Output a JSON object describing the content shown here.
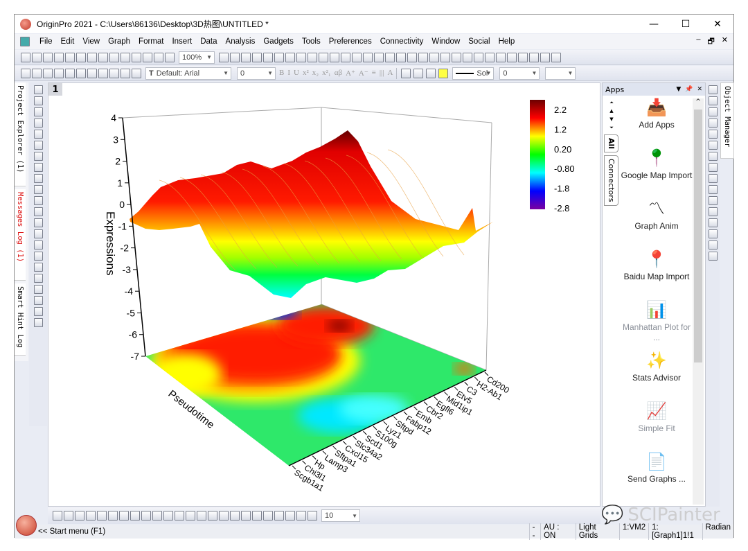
{
  "window": {
    "title": "OriginPro 2021 - C:\\Users\\86136\\Desktop\\3D热图\\UNTITLED *",
    "minimize": "—",
    "maximize": "☐",
    "close": "✕"
  },
  "menu": {
    "items": [
      "File",
      "Edit",
      "View",
      "Graph",
      "Format",
      "Insert",
      "Data",
      "Analysis",
      "Gadgets",
      "Tools",
      "Preferences",
      "Connectivity",
      "Window",
      "Social",
      "Help"
    ],
    "mdi": [
      "–",
      "🗗",
      "✕"
    ]
  },
  "toolbar1": {
    "zoom": "100%",
    "icons": [
      "new-project-icon",
      "new-folder-icon",
      "new-workbook-icon",
      "new-graph-icon",
      "new-matrix-icon",
      "new-function-icon",
      "new-layout-icon",
      "new-notes-icon",
      "new-excel-icon",
      "open-icon",
      "open-template-icon",
      "save-icon",
      "save-template-icon",
      "script-icon"
    ],
    "icons2": [
      "print-icon",
      "duplicate-icon",
      "refresh-icon",
      "film-icon",
      "code-builder-icon",
      "results-log-icon",
      "command-window-icon",
      "project-tree-icon",
      "find-icon",
      "worksheet-icon",
      "notes-icon",
      "settings-gear-icon",
      "add-column-icon",
      "sum-icon",
      "stats-icon",
      "sort-icon",
      "frequency-icon",
      "bar-chart-icon",
      "column-chart-icon",
      "box-chart-icon",
      "filter-icon",
      "clear-filter-icon",
      "reapply-filter-icon",
      "peak-icon",
      "x-icon",
      "y-icon",
      "z-icon",
      "error-icon",
      "none-icon",
      "first-icon",
      "prev-icon"
    ]
  },
  "toolbar2": {
    "font": "Default: Arial",
    "font_size": "0",
    "line_style": "Sol",
    "line_width": "0",
    "icons": [
      "import-ascii-icon",
      "import-multi-icon",
      "import-excel-icon",
      "import-wizard-icon",
      "copy-page-icon",
      "add-layer-icon",
      "merge-icon",
      "extract-icon",
      "cut-icon",
      "copy-icon",
      "paste-icon"
    ],
    "fmt": [
      "B",
      "I",
      "U",
      "x²",
      "x₂",
      "x²₁",
      "αβ",
      "A⁺",
      "A⁻",
      "≡",
      "|||",
      "A"
    ]
  },
  "left_tabs": [
    {
      "label": "Project Explorer (1)"
    },
    {
      "label": "Messages Log (1)"
    },
    {
      "label": "Smart Hint Log"
    }
  ],
  "left_tools": [
    "pointer-icon",
    "zoom-in-icon",
    "zoom-out-icon",
    "scale-icon",
    "data-reader-icon",
    "screen-reader-icon",
    "draw-data-icon",
    "region-icon",
    "text-tool-icon",
    "add-graph-icon",
    "arrow-tool-icon",
    "line-tool-icon",
    "rectangle-tool-icon",
    "hand-icon",
    "scale-in-icon",
    "rescale-icon",
    "mask-icon",
    "color-scale-icon",
    "layer-icon",
    "lock-icon",
    "new-layout-icon",
    "table-icon"
  ],
  "graph": {
    "layer": "1"
  },
  "chart_data": {
    "type": "3d-surface-with-projected-contour",
    "zlabel": "Expressions",
    "xlabel": "Pseudotime",
    "z_ticks": [
      4,
      3,
      2,
      1,
      0,
      -1,
      -2,
      -3,
      -4,
      -5,
      -6,
      -7
    ],
    "zlim": [
      -7,
      4
    ],
    "y_categories": [
      "Scgb1a1",
      "Chi3l1",
      "Hp",
      "Lamp3",
      "Sftpa1",
      "Cxcl15",
      "Slc34a2",
      "Scd1",
      "S100g",
      "Lyz1",
      "Sftpd",
      "Fabp12",
      "Emb",
      "Cbr2",
      "Egfl6",
      "Mid1ip1",
      "Etv5",
      "C3",
      "H2-Ab1",
      "Cd200"
    ],
    "colorbar": {
      "ticks": [
        "2.2",
        "1.2",
        "0.20",
        "-0.80",
        "-1.8",
        "-2.8"
      ],
      "colors": [
        "#6b0000",
        "#ff0000",
        "#ffff00",
        "#00ff00",
        "#00ffff",
        "#0000ff",
        "#7a00a0"
      ]
    },
    "surface_max": 3.2,
    "surface_min": -4.4
  },
  "apps": {
    "title": "Apps",
    "tabs": [
      "All",
      "Connectors"
    ],
    "items": [
      {
        "label": "Add Apps",
        "icon": "add-apps-icon",
        "dim": false
      },
      {
        "label": "Google Map Import",
        "icon": "google-map-pin-icon",
        "dim": false
      },
      {
        "label": "Graph Anim",
        "icon": "graph-anim-icon",
        "dim": false
      },
      {
        "label": "Baidu Map Import",
        "icon": "baidu-map-pin-icon",
        "dim": false
      },
      {
        "label": "Manhattan Plot for ...",
        "icon": "manhattan-plot-icon",
        "dim": true
      },
      {
        "label": "Stats Advisor",
        "icon": "magic-wand-icon",
        "dim": false
      },
      {
        "label": "Simple Fit",
        "icon": "simple-fit-icon",
        "dim": true
      },
      {
        "label": "Send Graphs ...",
        "icon": "send-graphs-word-icon",
        "dim": false
      }
    ]
  },
  "object_manager": {
    "label": "Object Manager"
  },
  "right_tools": [
    "ternary-icon",
    "axes-red-icon",
    "axes-icon",
    "axes-red2-icon",
    "refresh-icon",
    "speed-mode-icon",
    "layout1-icon",
    "layout2-icon",
    "layout3-icon",
    "layout4-icon",
    "frame-l-icon",
    "frame-t-icon",
    "frame-r-icon",
    "frame-box-icon",
    "frame-lb-icon",
    "frame-xy-icon"
  ],
  "bottom_toolbar": {
    "value": "10",
    "icons": [
      "line-icon",
      "scatter-icon",
      "line-symbol-icon",
      "column-icon",
      "area-icon",
      "contour-icon",
      "3d-surface-icon",
      "pie-icon",
      "polar-icon",
      "box-icon",
      "ternary-icon",
      "stats-icon",
      "template-icon",
      "rotate-cw-icon",
      "rotate-ccw-icon",
      "tilt-left-icon",
      "tilt-right-icon",
      "increase-z-icon",
      "decrease-z-icon",
      "perspective-icon",
      "extend-icon",
      "fit-frame-icon",
      "reset-icon",
      "cube-icon"
    ]
  },
  "status": {
    "start": "<< Start menu (F1)",
    "items": [
      "--",
      "AU : ON",
      "Light Grids",
      "1:VM2",
      "1:[Graph1]1!1",
      "Radian"
    ]
  },
  "watermark": "SCIPainter"
}
